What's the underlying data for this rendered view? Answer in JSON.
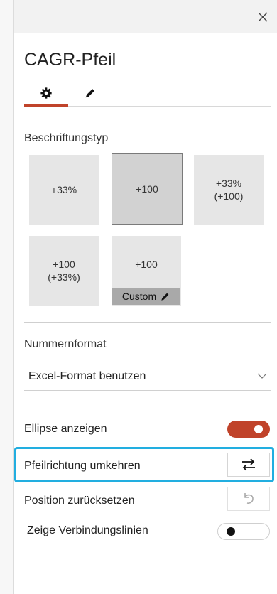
{
  "panel": {
    "title": "CAGR-Pfeil",
    "tabs": [
      {
        "name": "settings",
        "icon": "gear-icon"
      },
      {
        "name": "style",
        "icon": "pencil-icon"
      }
    ],
    "accent_color": "#c0432a",
    "highlight_color": "#22aee0"
  },
  "label_type": {
    "heading": "Beschriftungstyp",
    "options": [
      {
        "text": "+33%"
      },
      {
        "text": "+100",
        "selected": true
      },
      {
        "text": "+33%\n(+100)"
      },
      {
        "text": "+100\n(+33%)"
      },
      {
        "text": "+100",
        "custom_label": "Custom"
      }
    ]
  },
  "number_format": {
    "heading": "Nummernformat",
    "selected": "Excel-Format benutzen"
  },
  "options": {
    "ellipse": {
      "label": "Ellipse anzeigen",
      "on": true
    },
    "reverse": {
      "label": "Pfeilrichtung umkehren",
      "icon": "swap-arrows-icon"
    },
    "reset": {
      "label": "Position zurücksetzen",
      "icon": "undo-icon",
      "disabled": true
    },
    "connectors": {
      "label": "Zeige Verbindungslinien",
      "on": false
    }
  }
}
